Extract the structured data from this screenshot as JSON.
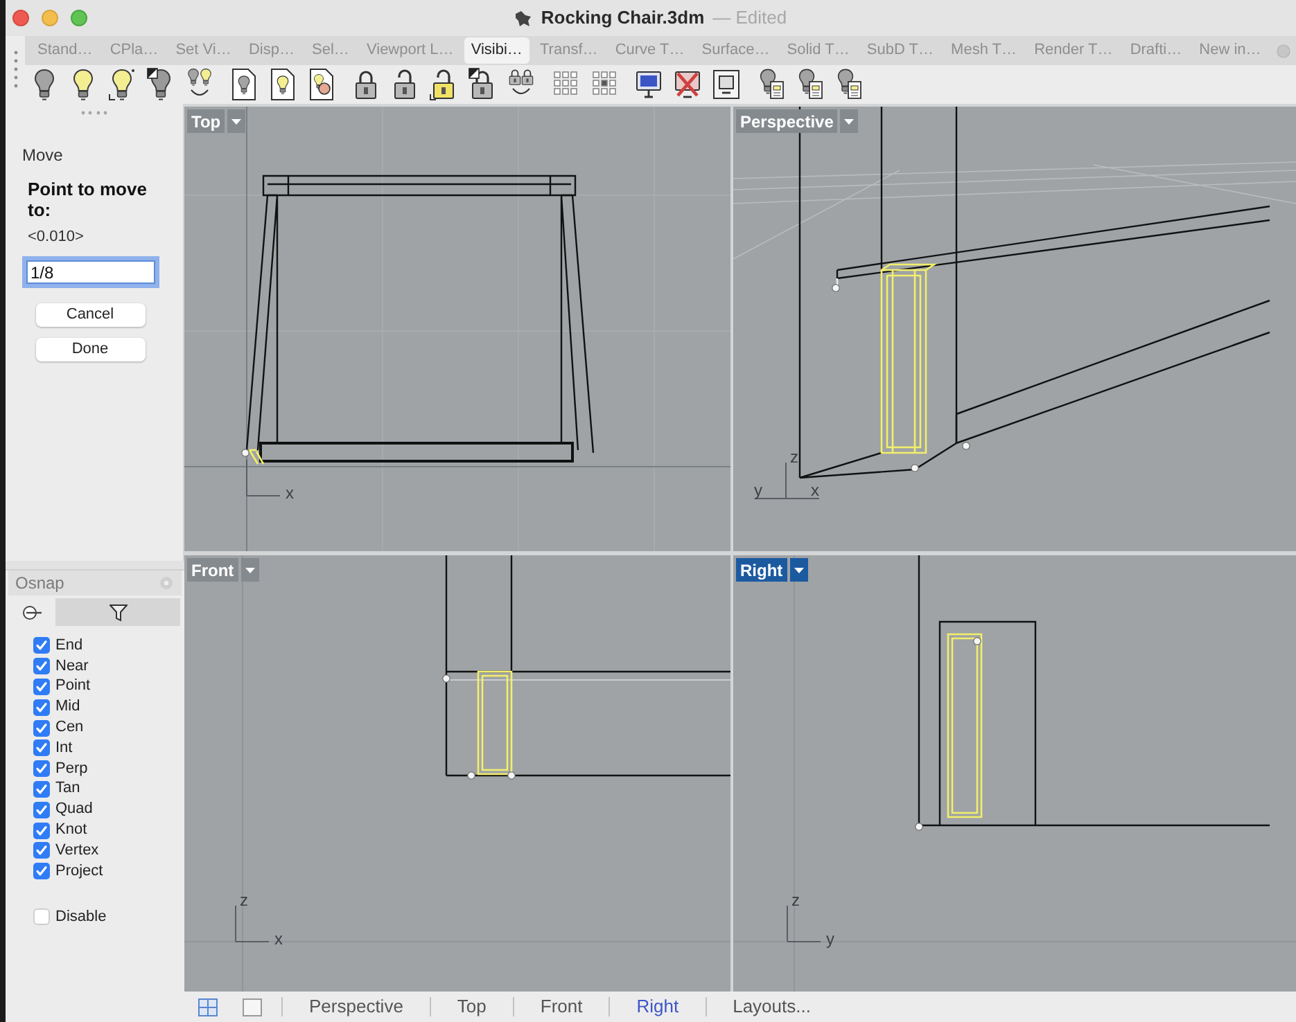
{
  "window": {
    "title": "Rocking Chair.3dm",
    "status": "— Edited"
  },
  "toolbar_tabs": [
    {
      "label": "Stand…",
      "selected": false
    },
    {
      "label": "CPla…",
      "selected": false
    },
    {
      "label": "Set Vi…",
      "selected": false
    },
    {
      "label": "Disp…",
      "selected": false
    },
    {
      "label": "Sel…",
      "selected": false
    },
    {
      "label": "Viewport L…",
      "selected": false
    },
    {
      "label": "Visibi…",
      "selected": true
    },
    {
      "label": "Transf…",
      "selected": false
    },
    {
      "label": "Curve T…",
      "selected": false
    },
    {
      "label": "Surface…",
      "selected": false
    },
    {
      "label": "Solid T…",
      "selected": false
    },
    {
      "label": "SubD T…",
      "selected": false
    },
    {
      "label": "Mesh T…",
      "selected": false
    },
    {
      "label": "Render T…",
      "selected": false
    },
    {
      "label": "Drafti…",
      "selected": false
    },
    {
      "label": "New in…",
      "selected": false
    }
  ],
  "command_panel": {
    "command": "Move",
    "prompt": "Point to move to:",
    "default_value": "<0.010>",
    "input": {
      "value": "1/8",
      "focused": true
    },
    "buttons": [
      "Cancel",
      "Done"
    ]
  },
  "osnap": {
    "title": "Osnap",
    "tabs": [
      {
        "kind": "snap",
        "selected": true
      },
      {
        "kind": "filter",
        "selected": false
      }
    ],
    "options": [
      {
        "label": "End",
        "checked": true
      },
      {
        "label": "Near",
        "checked": true
      },
      {
        "label": "Point",
        "checked": true
      },
      {
        "label": "Mid",
        "checked": true
      },
      {
        "label": "Cen",
        "checked": true
      },
      {
        "label": "Int",
        "checked": true
      },
      {
        "label": "Perp",
        "checked": true
      },
      {
        "label": "Tan",
        "checked": true
      },
      {
        "label": "Quad",
        "checked": true
      },
      {
        "label": "Knot",
        "checked": true
      },
      {
        "label": "Vertex",
        "checked": true
      },
      {
        "label": "Project",
        "checked": true
      }
    ],
    "disable": {
      "label": "Disable",
      "checked": false
    }
  },
  "viewports": [
    {
      "title": "Top",
      "kind": "top",
      "selected": false,
      "axis_labels": [
        {
          "label": "x",
          "kind": "horizontal"
        }
      ]
    },
    {
      "title": "Perspective",
      "kind": "perspective",
      "selected": false,
      "axis_labels": [
        {
          "label": "z",
          "kind": "vertical"
        },
        {
          "label": "y",
          "kind": "left"
        },
        {
          "label": "x",
          "kind": "right"
        }
      ]
    },
    {
      "title": "Front",
      "kind": "front",
      "selected": false,
      "axis_labels": [
        {
          "label": "z",
          "kind": "vertical"
        },
        {
          "label": "x",
          "kind": "horizontal"
        }
      ]
    },
    {
      "title": "Right",
      "kind": "right",
      "selected": true,
      "axis_labels": [
        {
          "label": "z",
          "kind": "vertical"
        },
        {
          "label": "y",
          "kind": "horizontal"
        }
      ]
    }
  ],
  "viewport_tabs": [
    {
      "label": "Perspective",
      "selected": false
    },
    {
      "label": "Top",
      "selected": false
    },
    {
      "label": "Front",
      "selected": false
    },
    {
      "label": "Right",
      "selected": true
    }
  ],
  "layouts_button": "Layouts..."
}
